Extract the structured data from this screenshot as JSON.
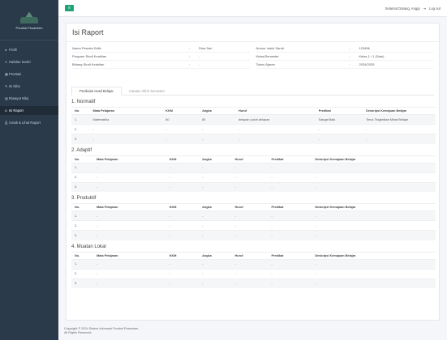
{
  "brand": {
    "name": "Pondok Pesantren"
  },
  "menu": [
    {
      "label": "Profil",
      "icon": "user-icon",
      "glyph": "●"
    },
    {
      "label": "Hafalan Santri",
      "icon": "check-icon",
      "glyph": "✔"
    },
    {
      "label": "Prestasi",
      "icon": "grid-icon",
      "glyph": "▦"
    },
    {
      "label": "Isi Nilai",
      "icon": "pencil-icon",
      "glyph": "✎"
    },
    {
      "label": "Riwayat Nilai",
      "icon": "table-icon",
      "glyph": "▤"
    },
    {
      "label": "Isi Raport",
      "icon": "book-icon",
      "glyph": "◘"
    },
    {
      "label": "Cetak & Lihat Raport",
      "icon": "print-icon",
      "glyph": "⎙"
    }
  ],
  "topbar": {
    "greeting": "Selamat Datang, Anggi",
    "logout": "Log out",
    "logout_icon": "logout-icon"
  },
  "page": {
    "title": "Isi Raport"
  },
  "info_left": [
    {
      "label": "Nama Peserta Didik",
      "sep": ":",
      "value": "Dina Sari"
    },
    {
      "label": "Program Studi Keahlian",
      "sep": ":",
      "value": "-"
    },
    {
      "label": "Bidang Studi Keahlian",
      "sep": ":",
      "value": "-"
    }
  ],
  "info_right": [
    {
      "label": "Nomor Induk Santri",
      "sep": ":",
      "value": "123456"
    },
    {
      "label": "Kelas/Semester",
      "sep": ":",
      "value": "Kelas 1 / 1 (Satu)"
    },
    {
      "label": "Tahun Ajaran",
      "sep": ":",
      "value": "2024/2025"
    }
  ],
  "tabs": [
    "Penilaian Hasil Belajar",
    "Catatan Akhir Semester"
  ],
  "columns": [
    "No.",
    "Mata Pelajaran",
    "KKM",
    "Angka",
    "Huruf",
    "Predikat",
    "Deskripsi Kemajuan Belajar"
  ],
  "sections": [
    {
      "title": "1. Normatif",
      "rows": [
        [
          "1.",
          "Matematika",
          "80",
          "80",
          "delapan puluh delapan",
          "Sangat Baik",
          "Terus Tingkatkan Minat Belajar"
        ],
        [
          "2.",
          "-",
          "-",
          "-",
          "-",
          "-",
          "-"
        ],
        [
          "3.",
          "-",
          "-",
          "-",
          "-",
          "-",
          "-"
        ]
      ]
    },
    {
      "title": "2. Adaptif",
      "rows": [
        [
          "1.",
          "-",
          "-",
          "-",
          "-",
          "-",
          "-"
        ],
        [
          "2.",
          "-",
          "-",
          "-",
          "-",
          "-",
          "-"
        ],
        [
          "3.",
          "-",
          "-",
          "-",
          "-",
          "-",
          "-"
        ]
      ]
    },
    {
      "title": "3. Produktif",
      "rows": [
        [
          "1.",
          "-",
          "-",
          "-",
          "-",
          "-",
          "-"
        ],
        [
          "2.",
          "-",
          "-",
          "-",
          "-",
          "-",
          "-"
        ],
        [
          "3.",
          "-",
          "-",
          "-",
          "-",
          "-",
          "-"
        ]
      ]
    },
    {
      "title": "4. Muatan Lokal",
      "rows": [
        [
          "1.",
          "-",
          "-",
          "-",
          "-",
          "-",
          "-"
        ],
        [
          "2.",
          "-",
          "-",
          "-",
          "-",
          "-",
          "-"
        ],
        [
          "3.",
          "-",
          "-",
          "-",
          "-",
          "-",
          "-"
        ]
      ]
    }
  ],
  "footer": {
    "line1": "Copyright © 2024 Sistem Informasi Pondok Pesantren.",
    "line2": "All Rights Reserved."
  },
  "colors": {
    "sidebar": "#2b3a4a",
    "accent": "#1fa37a"
  }
}
